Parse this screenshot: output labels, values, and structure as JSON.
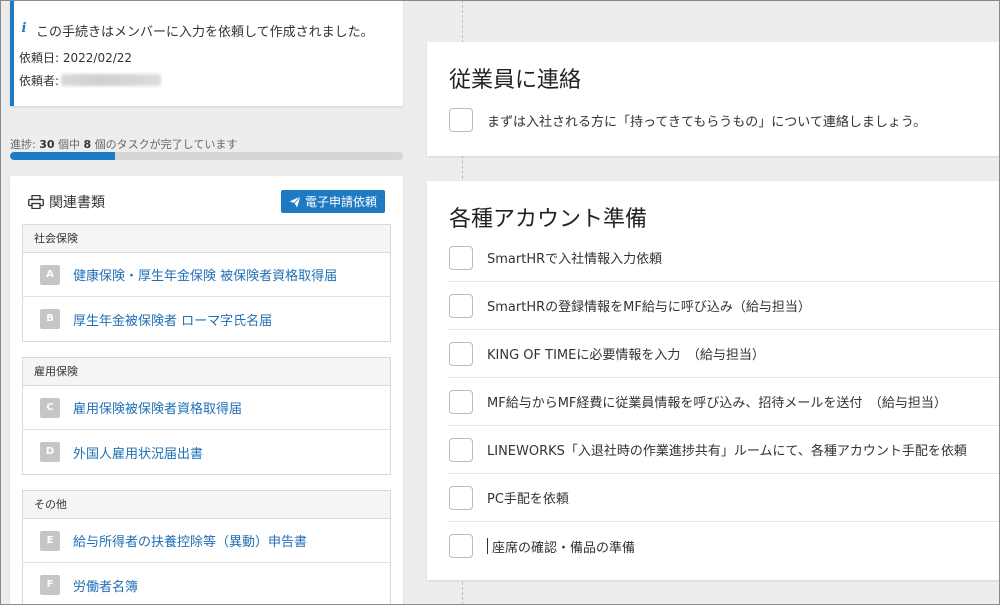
{
  "info": {
    "message": "この手続きはメンバーに入力を依頼して作成されました。",
    "request_date": "依頼日: 2022/02/22",
    "requester_label": "依頼者:"
  },
  "progress": {
    "prefix": "進捗: ",
    "total": "30",
    "mid": " 個中 ",
    "done": "8",
    "suffix": " 個のタスクが完了しています",
    "fraction": 0.267
  },
  "docs": {
    "title": "関連書類",
    "esign_label": "電子申請依頼",
    "groups": [
      {
        "name": "社会保険",
        "items": [
          {
            "badge": "A",
            "label": "健康保険・厚生年金保険 被保険者資格取得届"
          },
          {
            "badge": "B",
            "label": "厚生年金被保険者 ローマ字氏名届"
          }
        ]
      },
      {
        "name": "雇用保険",
        "items": [
          {
            "badge": "C",
            "label": "雇用保険被保険者資格取得届"
          },
          {
            "badge": "D",
            "label": "外国人雇用状況届出書"
          }
        ]
      },
      {
        "name": "その他",
        "items": [
          {
            "badge": "E",
            "label": "給与所得者の扶養控除等（異動）申告書"
          },
          {
            "badge": "F",
            "label": "労働者名簿"
          }
        ]
      }
    ]
  },
  "sections": [
    {
      "title": "従業員に連絡",
      "tasks": [
        "まずは入社される方に「持ってきてもらうもの」について連絡しましょう。"
      ]
    },
    {
      "title": "各種アカウント準備",
      "tasks": [
        "SmartHRで入社情報入力依頼",
        "SmartHRの登録情報をMF給与に呼び込み（給与担当）",
        "KING OF TIMEに必要情報を入力　（給与担当）",
        "MF給与からMF経費に従業員情報を呼び込み、招待メールを送付　（給与担当）",
        "LINEWORKS「入退社時の作業進捗共有」ルームにて、各種アカウント手配を依頼",
        "PC手配を依頼",
        "座席の確認・備品の準備"
      ]
    }
  ],
  "colors": {
    "accent": "#1f7ac4",
    "link": "#1f6fb5"
  }
}
